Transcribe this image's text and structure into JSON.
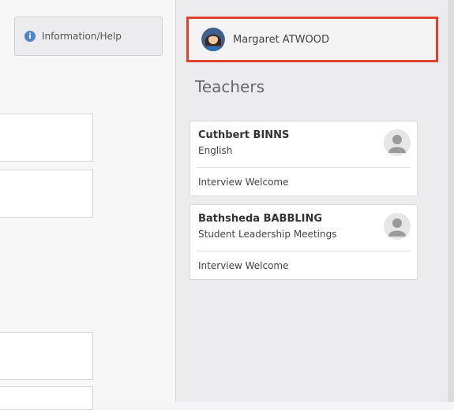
{
  "header": {
    "info_button_label": "Information/Help",
    "user_name": "Margaret ATWOOD"
  },
  "teachers": {
    "heading": "Teachers",
    "cards": [
      {
        "name": "Cuthbert BINNS",
        "subject": "English",
        "status": "Interview Welcome"
      },
      {
        "name": "Bathsheda BABBLING",
        "subject": "Student Leadership Meetings",
        "status": "Interview Welcome"
      }
    ]
  },
  "colors": {
    "highlight_border": "#e0402e",
    "info_icon": "#4d87c7"
  },
  "icons": {
    "info": "info-icon",
    "user_avatar": "user-avatar",
    "teacher_avatar": "person-placeholder-icon"
  }
}
